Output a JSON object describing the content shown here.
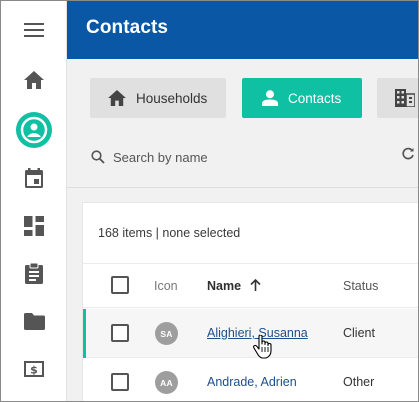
{
  "header": {
    "title": "Contacts"
  },
  "rail": {
    "items": [
      {
        "icon": "menu-icon"
      },
      {
        "icon": "home-icon"
      },
      {
        "icon": "person-circle-icon",
        "active": true
      },
      {
        "icon": "calendar-icon"
      },
      {
        "icon": "dashboard-icon"
      },
      {
        "icon": "clipboard-icon"
      },
      {
        "icon": "folder-icon"
      },
      {
        "icon": "billing-icon"
      }
    ],
    "active_color": "#0fc0a3"
  },
  "tabs": [
    {
      "label": "Households",
      "icon": "home-icon"
    },
    {
      "label": "Contacts",
      "icon": "person-icon",
      "selected": true
    },
    {
      "label": "",
      "icon": "building-icon"
    }
  ],
  "search": {
    "placeholder": "Search by name"
  },
  "grid": {
    "summary": "168 items | none selected",
    "columns": {
      "icon": "Icon",
      "name": "Name",
      "status": "Status"
    },
    "sort": {
      "column": "Name",
      "direction": "ascending"
    },
    "rows": [
      {
        "initials": "SA",
        "name": "Alighieri, Susanna",
        "status": "Client",
        "hovered": true
      },
      {
        "initials": "AA",
        "name": "Andrade, Adrien",
        "status": "Other"
      }
    ]
  },
  "colors": {
    "header": "#0a57a6",
    "accent": "#0fc0a3",
    "link": "#1d4f8c"
  }
}
